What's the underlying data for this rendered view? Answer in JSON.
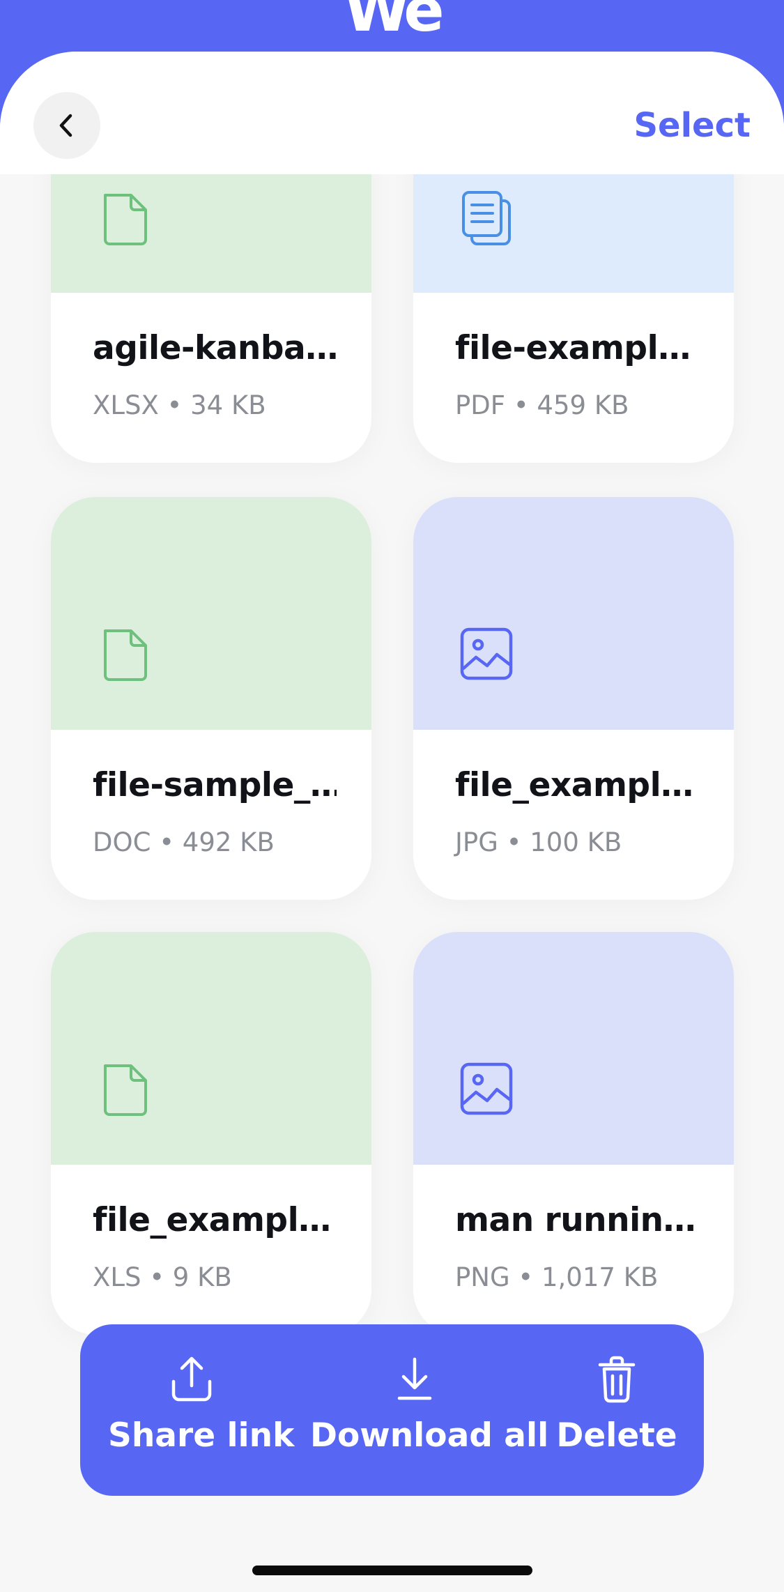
{
  "header": {
    "logo_text": "We",
    "select_label": "Select"
  },
  "files": [
    {
      "name": "agile-kanba…",
      "meta": "XLSX • 34 KB",
      "kind": "doc",
      "thumb_color": "#DCEFDD",
      "icon_color": "#6DC17C"
    },
    {
      "name": "file-exampl…",
      "meta": "PDF • 459 KB",
      "kind": "pdf",
      "thumb_color": "#DDEBFD",
      "icon_color": "#4A8FE6"
    },
    {
      "name": "file-sample_…",
      "meta": "DOC • 492 KB",
      "kind": "doc",
      "thumb_color": "#DCEFDD",
      "icon_color": "#6DC17C"
    },
    {
      "name": "file_exampl…",
      "meta": "JPG • 100 KB",
      "kind": "image",
      "thumb_color": "#DBE0FA",
      "icon_color": "#5767F3"
    },
    {
      "name": "file_exampl…",
      "meta": "XLS • 9 KB",
      "kind": "doc",
      "thumb_color": "#DCEFDD",
      "icon_color": "#6DC17C"
    },
    {
      "name": "man runnin…",
      "meta": "PNG • 1,017 KB",
      "kind": "image",
      "thumb_color": "#DBE0FA",
      "icon_color": "#5767F3"
    }
  ],
  "actions": {
    "share_label": "Share link",
    "download_label": "Download all",
    "delete_label": "Delete"
  },
  "colors": {
    "accent": "#5767F3"
  }
}
